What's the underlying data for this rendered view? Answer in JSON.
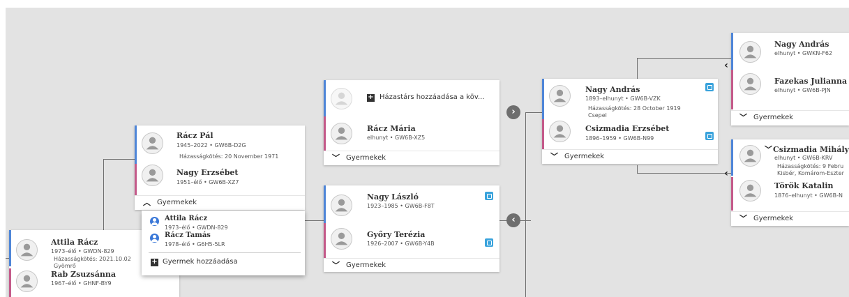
{
  "children_label": "Gyermekek",
  "card_a": {
    "p1": {
      "name": "Attila Rácz",
      "meta": "1973–élő • GWDN-829"
    },
    "marriage": "Házasságkötés: 2021.10.02",
    "marriage_place": "Gyömrő",
    "p2": {
      "name": "Rab Zsuzsánna",
      "meta": "1967–élő • GHNF-BY9"
    }
  },
  "card_b": {
    "p1": {
      "name": "Rácz Pál",
      "meta": "1945–2022 • GW6B-D2G"
    },
    "marriage": "Házasságkötés: 20 November 1971",
    "p2": {
      "name": "Nagy Erzsébet",
      "meta": "1951–élő • GW6B-XZ7"
    }
  },
  "children_popup": {
    "items": [
      {
        "name": "Attila Rácz",
        "meta": "1973–élő • GWDN-829"
      },
      {
        "name": "Rácz Tamás",
        "meta": "1978–élő • G6H5-5LR"
      }
    ],
    "add_label": "Gyermek hozzáadása"
  },
  "card_c": {
    "add_spouse_label": "Házastárs hozzáadása a köv...",
    "p2": {
      "name": "Rácz Mária",
      "meta": "elhunyt • GW6B-XZ5"
    }
  },
  "card_d": {
    "p1": {
      "name": "Nagy László",
      "meta": "1923–1985 • GW6B-F8T"
    },
    "p2": {
      "name": "Győry Terézia",
      "meta": "1926–2007 • GW6B-Y4B"
    }
  },
  "card_e": {
    "p1": {
      "name": "Nagy András",
      "meta": "1893–elhunyt • GW6B-VZK"
    },
    "marriage": "Házasságkötés: 28 October 1919",
    "marriage_place": "Csepel",
    "p2": {
      "name": "Csizmadia Erzsébet",
      "meta": "1896–1959 • GW6B-N99"
    }
  },
  "card_f": {
    "p1": {
      "name": "Nagy András",
      "meta": "elhunyt • GWKN-F62"
    },
    "p2": {
      "name": "Fazekas Julianna",
      "meta": "elhunyt • GW6B-PJN"
    }
  },
  "card_g": {
    "p1": {
      "name": "Csizmadia Mihály",
      "meta": "elhunyt • GW6B-KRV"
    },
    "marriage": "Házasságkötés: 9 Febru",
    "marriage_place": "Kisbér, Komárom-Eszter",
    "p2": {
      "name": "Török Katalin",
      "meta": "1876–elhunyt • GW6B-N"
    }
  },
  "icons": {
    "expand_right": "chevron-right-icon",
    "collapse_left": "chevron-left-icon",
    "tree": "family-tree-icon"
  },
  "colors": {
    "male_bar": "#4f86d8",
    "female_bar": "#c45a8a",
    "tree_icon": "#3aa3dc",
    "background": "#e3e3e3"
  }
}
